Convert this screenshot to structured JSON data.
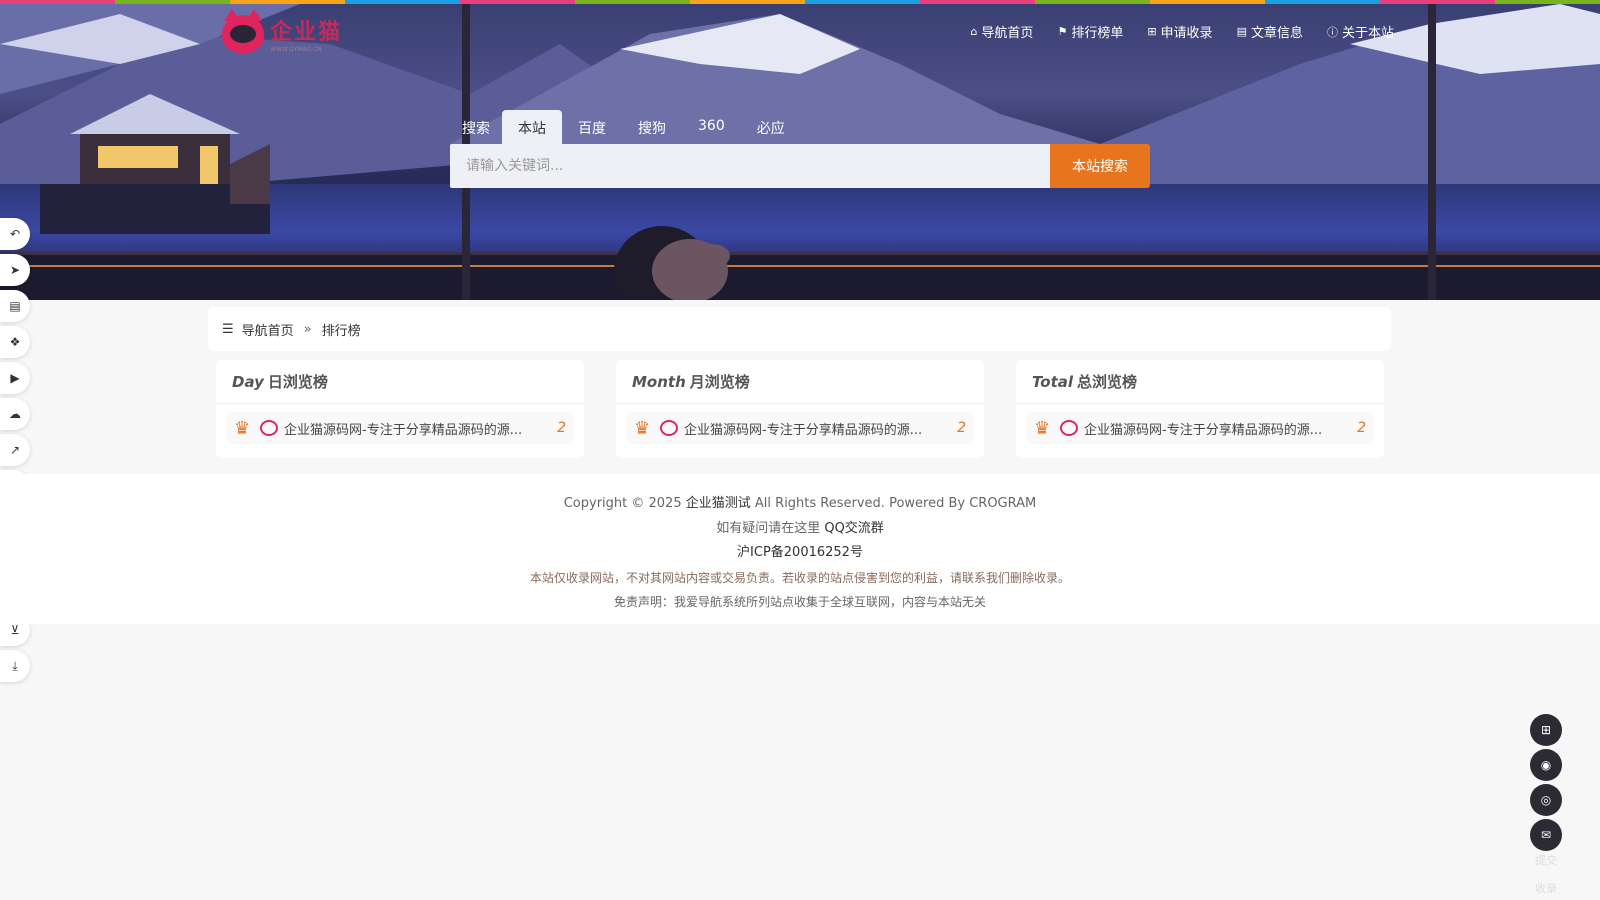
{
  "site": {
    "logo_name": "企业猫",
    "logo_url": "WWW.QYMAO.CN"
  },
  "topnav": [
    {
      "icon": "home-icon",
      "glyph": "⌂",
      "label": "导航首页"
    },
    {
      "icon": "flag-icon",
      "glyph": "⚑",
      "label": "排行榜单"
    },
    {
      "icon": "plus-square-icon",
      "glyph": "⊞",
      "label": "申请收录"
    },
    {
      "icon": "book-icon",
      "glyph": "▤",
      "label": "文章信息"
    },
    {
      "icon": "info-icon",
      "glyph": "ⓘ",
      "label": "关于本站"
    }
  ],
  "search": {
    "tabs": [
      "搜索",
      "本站",
      "百度",
      "搜狗",
      "360",
      "必应"
    ],
    "active_tab": "本站",
    "placeholder": "请输入关键词...",
    "button_label": "本站搜索"
  },
  "left_bar": [
    {
      "icon": "undo-icon",
      "glyph": "↶"
    },
    {
      "icon": "paper-plane-icon",
      "glyph": "➤"
    },
    {
      "icon": "file-icon",
      "glyph": "▤"
    },
    {
      "icon": "cubes-icon",
      "glyph": "❖"
    },
    {
      "icon": "youtube-icon",
      "glyph": "▶"
    },
    {
      "icon": "cloud-icon",
      "glyph": "☁"
    },
    {
      "icon": "line-chart-icon",
      "glyph": "↗"
    },
    {
      "icon": "graduation-cap-icon",
      "glyph": "▲"
    },
    {
      "icon": "yen-icon",
      "glyph": "¥"
    },
    {
      "icon": "wrench-icon",
      "glyph": "✎"
    },
    {
      "icon": "keyboard-icon",
      "glyph": "⌨"
    },
    {
      "icon": "shopping-cart-icon",
      "glyph": "⊻"
    },
    {
      "icon": "download-icon",
      "glyph": "⤓"
    }
  ],
  "breadcrumb": {
    "home": "导航首页",
    "sep": "»",
    "current": "排行榜"
  },
  "cards": [
    {
      "en": "Day",
      "zh": "日浏览榜",
      "item_title": "企业猫源码网-专注于分享精品源码的源...",
      "item_count": "2"
    },
    {
      "en": "Month",
      "zh": "月浏览榜",
      "item_title": "企业猫源码网-专注于分享精品源码的源...",
      "item_count": "2"
    },
    {
      "en": "Total",
      "zh": "总浏览榜",
      "item_title": "企业猫源码网-专注于分享精品源码的源...",
      "item_count": "2"
    }
  ],
  "footer": {
    "copyright_prefix": "Copyright © 2025",
    "site_name": "企业猫测试",
    "copyright_suffix": "All Rights Reserved. Powered By CROGRAM",
    "qq_prefix": "如有疑问请在这里",
    "qq_link": "QQ交流群",
    "icp": "沪ICP备20016252号",
    "notice": "本站仅收录网站，不对其网站内容或交易负责。若收录的站点侵害到您的利益，请联系我们删除收录。",
    "disclaimer": "免责声明：我爱导航系统所列站点收集于全球互联网，内容与本站无关"
  },
  "right_bar": [
    {
      "icon": "plus-square-icon",
      "glyph": "⊞"
    },
    {
      "icon": "qq-icon",
      "glyph": "◉"
    },
    {
      "icon": "wechat-icon",
      "glyph": "◎"
    },
    {
      "icon": "envelope-icon",
      "glyph": "✉"
    }
  ],
  "ghost_text": {
    "submit": "提交",
    "collect": "收录"
  }
}
